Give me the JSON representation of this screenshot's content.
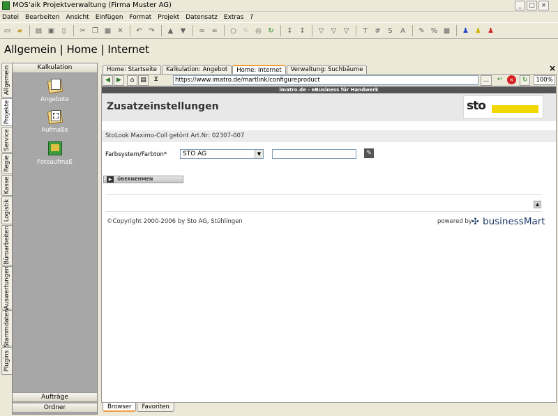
{
  "window": {
    "title": "MOS'aik Projektverwaltung (Firma Muster AG)",
    "minimize": "_",
    "maximize": "□",
    "close": "×"
  },
  "menu": [
    "Datei",
    "Bearbeiten",
    "Ansicht",
    "Einfügen",
    "Format",
    "Projekt",
    "Datensatz",
    "Extras",
    "?"
  ],
  "toolbar_icons": [
    "new-icon",
    "open-icon",
    "print-icon",
    "preview-icon",
    "copy-doc-icon",
    "cut-icon",
    "copy-icon",
    "paste-icon",
    "delete-icon",
    "undo-icon",
    "redo-icon",
    "up-arrow-icon",
    "down-arrow-icon",
    "binoculars-icon",
    "find-next-icon",
    "zoom-icon",
    "hand-icon",
    "search-replace-icon",
    "refresh-icon",
    "sort-asc-icon",
    "sort-desc-icon",
    "filter-icon",
    "filter-clear-icon",
    "filter-edit-icon",
    "text-icon",
    "hash-icon",
    "s-icon",
    "a-icon",
    "brush-icon",
    "percent-icon",
    "table-icon",
    "user-blue-icon",
    "user-yellow-icon",
    "user-red-icon"
  ],
  "toolbar_glyphs": {
    "T": "T",
    "hash": "#",
    "S": "S",
    "A": "A",
    "percent": "%"
  },
  "page_title": "Allgemein | Home | Internet",
  "vertical_tabs": [
    "Allgemein",
    "Projekte",
    "Service",
    "Regie",
    "Kasse",
    "Logistik",
    "Büroarbeiten",
    "Auswertungen",
    "Stammdaten",
    "Plugins"
  ],
  "left_panel": {
    "header": "Kalkulation",
    "items": [
      "Angebote",
      "Aufmaße",
      "Fotoaufmaß"
    ],
    "footer_items": [
      "Aufträge",
      "Ordner"
    ]
  },
  "browser_tabs": [
    "Home: Startseite",
    "Kalkulation: Angebot",
    "Home: Internet",
    "Verwaltung: Suchbäume"
  ],
  "active_browser_tab": "Home: Internet",
  "close_glyph": "×",
  "nav": {
    "url": "https://www.imatro.de/martlink/configureproduct",
    "more": "...",
    "zoom": "100%"
  },
  "site": {
    "header_bar": "imatro.de - eBusiness für Handwerk",
    "heading": "Zusatzeinstellungen",
    "logo_text": "sto",
    "product_line": "StoLook Maximo-Coll getönt  Art.Nr: 02307-007",
    "farb_label": "Farbsystem/Farbton*",
    "farb_value": "STO AG",
    "farb_text_value": "",
    "button_label": "ÜBERNEHMEN",
    "copyright": "©Copyright 2000-2006 by Sto AG, Stühlingen",
    "powered_by": "powered by",
    "bm_name": "businessMart"
  },
  "bottom_tabs": [
    "Browser",
    "Favoriten"
  ],
  "colors": {
    "sto_yellow": "#f2d800",
    "tab_accent": "#f0a040",
    "brand_blue": "#1e3a6a"
  }
}
